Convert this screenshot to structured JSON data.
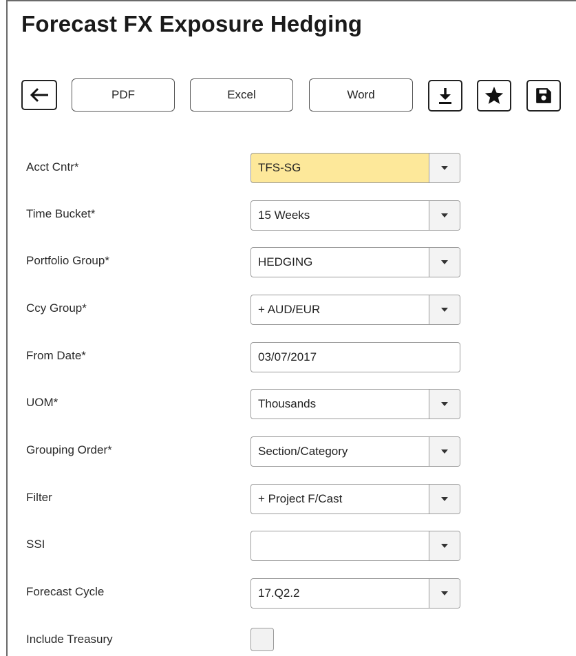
{
  "page": {
    "title": "Forecast FX Exposure Hedging"
  },
  "toolbar": {
    "back_icon": "arrow-left-icon",
    "pdf_label": "PDF",
    "excel_label": "Excel",
    "word_label": "Word",
    "download_icon": "download-icon",
    "favorite_icon": "star-icon",
    "save_icon": "floppy-disk-icon"
  },
  "form": {
    "acct_cntr": {
      "label": "Acct Cntr*",
      "value": "TFS-SG"
    },
    "time_bucket": {
      "label": "Time Bucket*",
      "value": "15 Weeks"
    },
    "portfolio_group": {
      "label": "Portfolio Group*",
      "value": "HEDGING"
    },
    "ccy_group": {
      "label": "Ccy Group*",
      "value": "+ AUD/EUR"
    },
    "from_date": {
      "label": "From Date*",
      "value": "03/07/2017"
    },
    "uom": {
      "label": "UOM*",
      "value": "Thousands"
    },
    "grouping_order": {
      "label": "Grouping Order*",
      "value": "Section/Category"
    },
    "filter": {
      "label": "Filter",
      "value": "+ Project F/Cast"
    },
    "ssi": {
      "label": "SSI",
      "value": ""
    },
    "forecast_cycle": {
      "label": "Forecast Cycle",
      "value": "17.Q2.2"
    },
    "include_treasury": {
      "label": "Include Treasury",
      "checked": false
    }
  },
  "colors": {
    "highlight_field": "#fde89a",
    "border": "#9a9a9a"
  }
}
